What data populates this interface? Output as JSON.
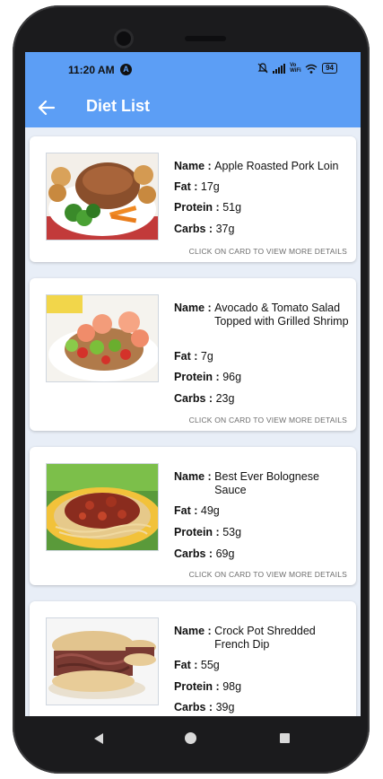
{
  "status": {
    "time": "11:20 AM",
    "alarm": "A",
    "volte": "Vo WiFi",
    "battery": "94"
  },
  "appbar": {
    "title": "Diet List",
    "back_icon": "arrow-left-icon"
  },
  "labels": {
    "name": "Name :",
    "fat": "Fat :",
    "protein": "Protein :",
    "carbs": "Carbs :"
  },
  "hint": "CLICK ON CARD TO VIEW MORE DETAILS",
  "cards": [
    {
      "name": "Apple Roasted Pork Loin",
      "fat": "17g",
      "protein": "51g",
      "carbs": "37g"
    },
    {
      "name": "Avocado & Tomato Salad Topped with Grilled Shrimp",
      "fat": "7g",
      "protein": "96g",
      "carbs": "23g"
    },
    {
      "name": "Best Ever Bolognese Sauce",
      "fat": "49g",
      "protein": "53g",
      "carbs": "69g"
    },
    {
      "name": "Crock Pot Shredded French Dip",
      "fat": "55g",
      "protein": "98g",
      "carbs": "39g"
    }
  ],
  "colors": {
    "appbar": "#5c9ef5",
    "background": "#e8eef7",
    "card": "#ffffff"
  }
}
